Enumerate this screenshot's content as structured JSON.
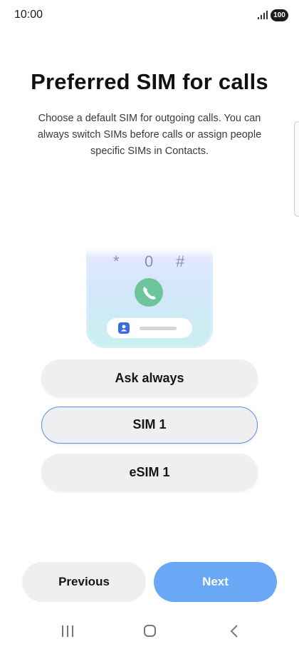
{
  "status_bar": {
    "time": "10:00",
    "battery": "100",
    "icons": [
      "signal-icon",
      "battery-icon"
    ]
  },
  "header": {
    "title": "Preferred SIM for calls",
    "description": "Choose a default SIM for outgoing calls. You can always switch SIMs before calls or assign people specific SIMs in Contacts."
  },
  "illustration": {
    "keys": [
      "*",
      "0",
      "#"
    ],
    "icons": [
      "call-icon",
      "contact-icon"
    ]
  },
  "options": {
    "items": [
      {
        "label": "Ask always",
        "selected": false
      },
      {
        "label": "SIM 1",
        "selected": true
      },
      {
        "label": "eSIM 1",
        "selected": false
      }
    ],
    "selected_color": "#5b8fe6"
  },
  "footer": {
    "previous_label": "Previous",
    "next_label": "Next",
    "next_color": "#6aa7f5"
  },
  "nav_bar": {
    "icons": [
      "recents-icon",
      "home-icon",
      "back-icon"
    ]
  }
}
